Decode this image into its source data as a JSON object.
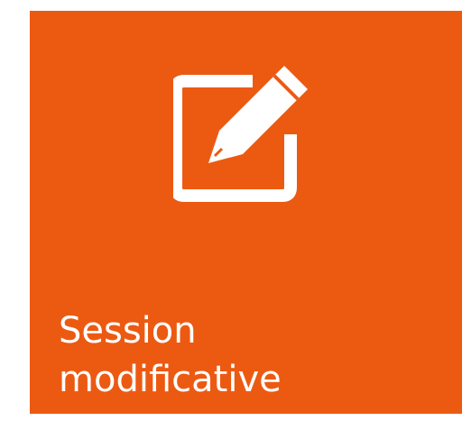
{
  "tile": {
    "icon": "edit-icon",
    "label_line1": "Session",
    "label_line2": "modificative",
    "background_color": "#ec5a12",
    "text_color": "#ffffff"
  }
}
